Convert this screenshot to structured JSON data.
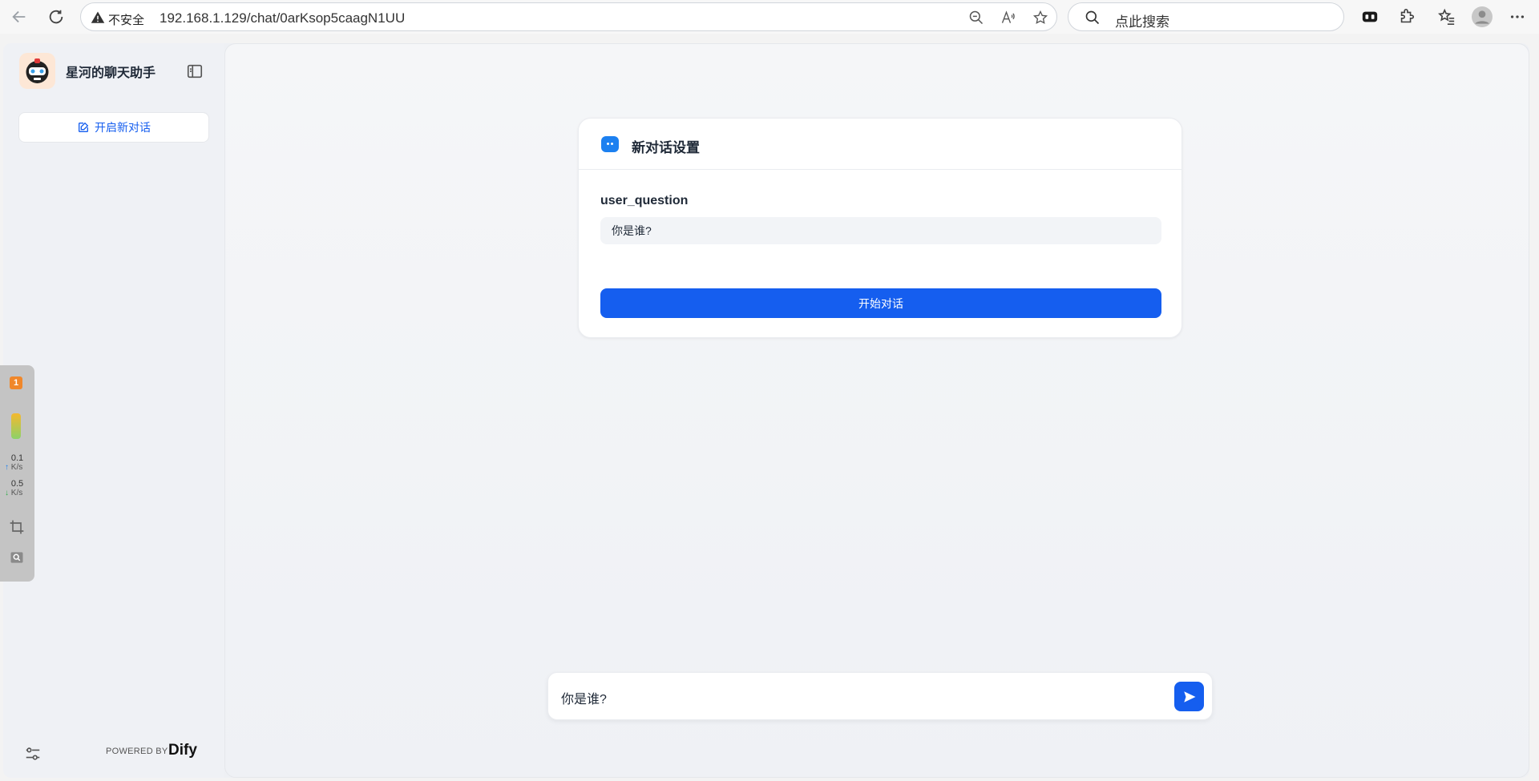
{
  "browser": {
    "insecure_label": "不安全",
    "url": "192.168.1.129/chat/0arKsop5caagN1UU",
    "search_placeholder": "点此搜索"
  },
  "sidebar": {
    "app_title": "星河的聊天助手",
    "new_chat_label": "开启新对话",
    "powered_by": "POWERED BY",
    "brand": "Dify"
  },
  "widget": {
    "badge": "1",
    "upload_value": "0.1",
    "upload_unit": "K/s",
    "download_value": "0.5",
    "download_unit": "K/s"
  },
  "card": {
    "title": "新对话设置",
    "field_label": "user_question",
    "field_value": "你是谁?",
    "start_label": "开始对话"
  },
  "chat": {
    "input_text": "你是谁?"
  },
  "colors": {
    "accent": "#155eef",
    "sidebar_bg": "#eff1f5",
    "card_icon": "#1c80f0"
  }
}
